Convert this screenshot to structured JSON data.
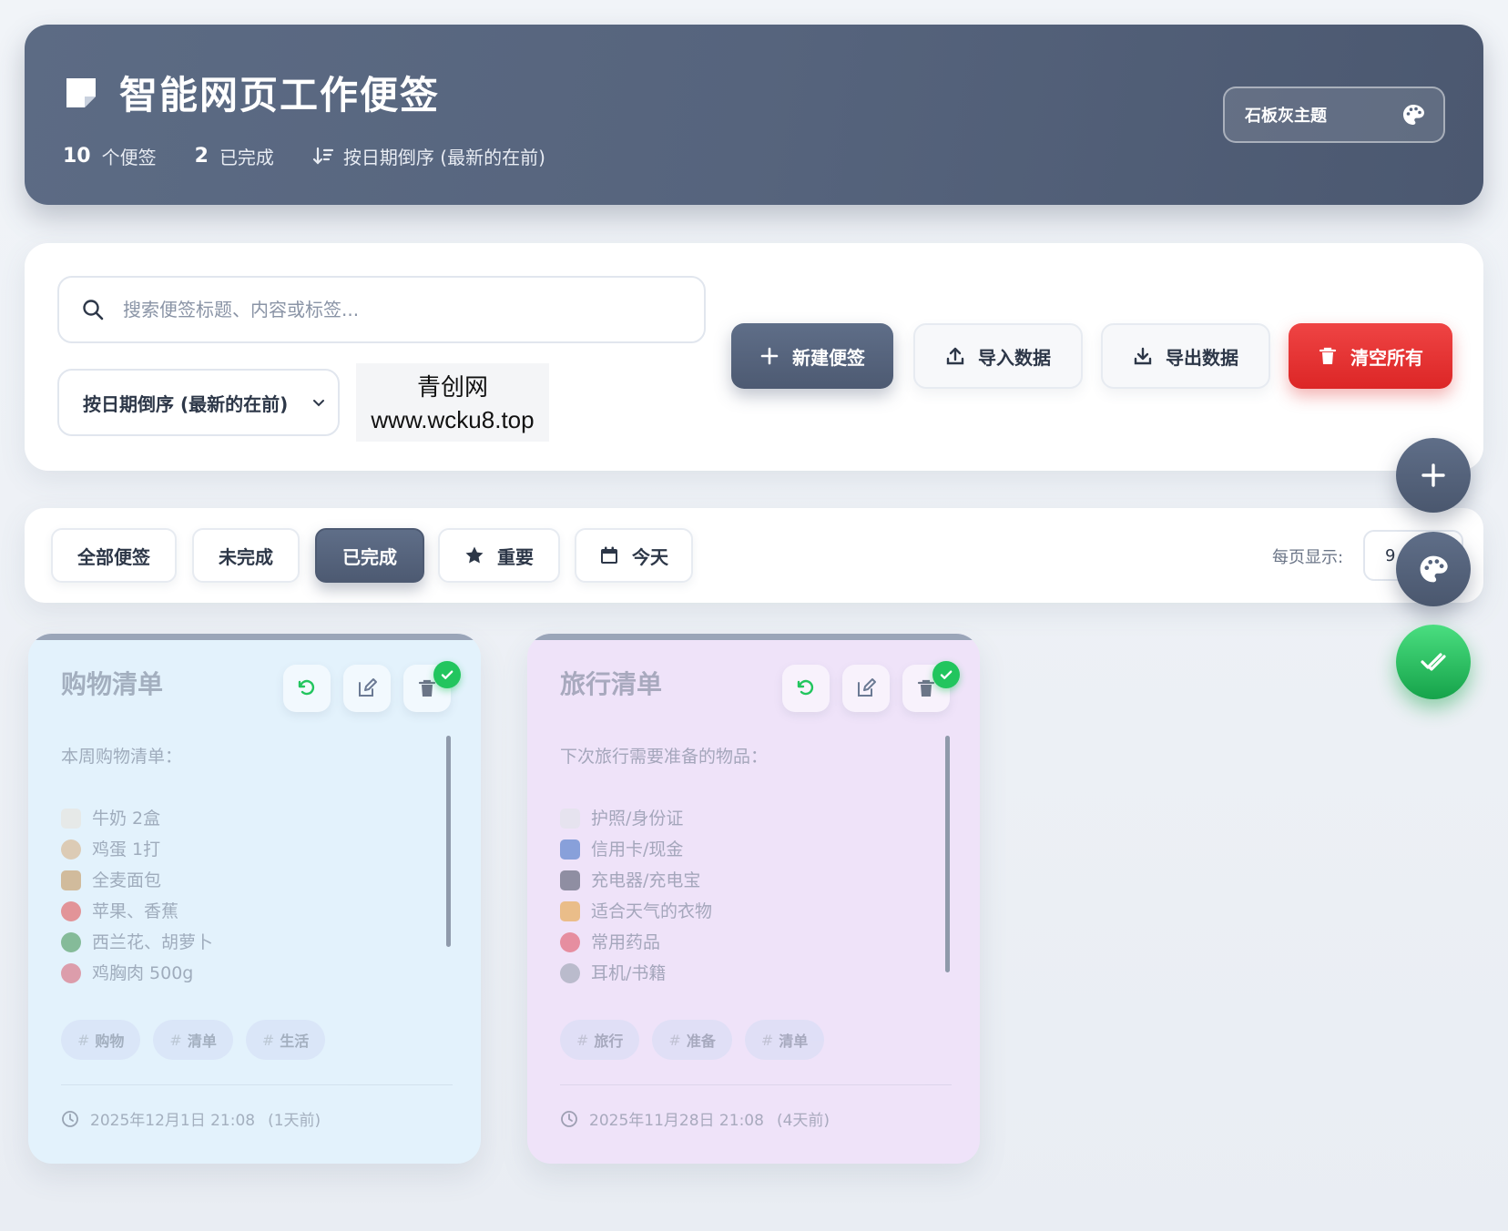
{
  "header": {
    "title": "智能网页工作便签",
    "notes_count": "10",
    "notes_label": "个便签",
    "done_count": "2",
    "done_label": "已完成",
    "sort_label": "按日期倒序 (最新的在前)",
    "theme_button": "石板灰主题"
  },
  "toolbar": {
    "search_placeholder": "搜索便签标题、内容或标签...",
    "sort_select": "按日期倒序 (最新的在前)",
    "watermark_line1": "青创网",
    "watermark_line2": "www.wcku8.top",
    "new_note": "新建便签",
    "import": "导入数据",
    "export": "导出数据",
    "clear_all": "清空所有"
  },
  "filters": {
    "all": "全部便签",
    "incomplete": "未完成",
    "completed": "已完成",
    "important": "重要",
    "today": "今天",
    "per_page_label": "每页显示:",
    "per_page_value": "9"
  },
  "notes": [
    {
      "title": "购物清单",
      "intro": "本周购物清单：",
      "items": [
        "牛奶 2盒",
        "鸡蛋 1打",
        "全麦面包",
        "苹果、香蕉",
        "西兰花、胡萝卜",
        "鸡胸肉 500g"
      ],
      "tags": [
        "购物",
        "清单",
        "生活"
      ],
      "date": "2025年12月1日 21:08",
      "relative": "(1天前)",
      "completed": true
    },
    {
      "title": "旅行清单",
      "intro": "下次旅行需要准备的物品：",
      "items": [
        "护照/身份证",
        "信用卡/现金",
        "充电器/充电宝",
        "适合天气的衣物",
        "常用药品",
        "耳机/书籍"
      ],
      "tags": [
        "旅行",
        "准备",
        "清单"
      ],
      "date": "2025年11月28日 21:08",
      "relative": "(4天前)",
      "completed": true
    }
  ],
  "colors": {
    "header_bg": "#56647d",
    "danger": "#dc2626",
    "success": "#22c55e",
    "card_blue": "#e3f2fc",
    "card_purple": "#efe3f9"
  }
}
